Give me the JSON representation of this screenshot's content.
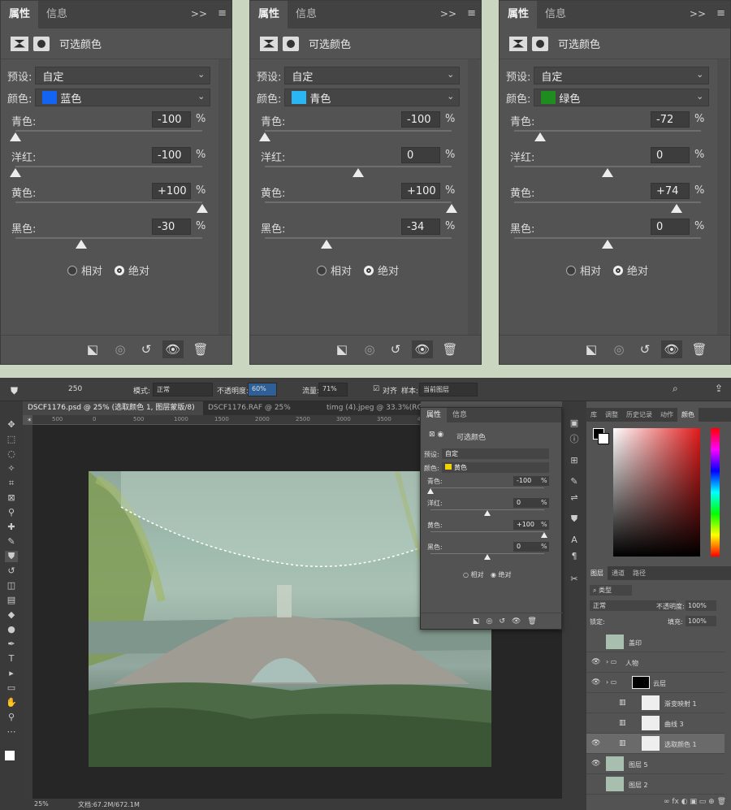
{
  "panels": [
    {
      "tabs": [
        "属性",
        "信息"
      ],
      "title": "可选颜色",
      "preset_label": "预设:",
      "preset_value": "自定",
      "color_label": "颜色:",
      "color_value": "蓝色",
      "color_swatch": "#1464f4",
      "sliders": [
        {
          "label": "青色:",
          "value": "-100",
          "pct": "%",
          "level": -100
        },
        {
          "label": "洋红:",
          "value": "-100",
          "pct": "%",
          "level": -100
        },
        {
          "label": "黄色:",
          "value": "+100",
          "pct": "%",
          "level": 100
        },
        {
          "label": "黑色:",
          "value": "-30",
          "pct": "%",
          "level": -30
        }
      ],
      "radio_relative": "相对",
      "radio_absolute": "绝对"
    },
    {
      "tabs": [
        "属性",
        "信息"
      ],
      "title": "可选颜色",
      "preset_label": "预设:",
      "preset_value": "自定",
      "color_label": "颜色:",
      "color_value": "青色",
      "color_swatch": "#2ab6f4",
      "sliders": [
        {
          "label": "青色:",
          "value": "-100",
          "pct": "%",
          "level": -100
        },
        {
          "label": "洋红:",
          "value": "0",
          "pct": "%",
          "level": 0
        },
        {
          "label": "黄色:",
          "value": "+100",
          "pct": "%",
          "level": 100
        },
        {
          "label": "黑色:",
          "value": "-34",
          "pct": "%",
          "level": -34
        }
      ],
      "radio_relative": "相对",
      "radio_absolute": "绝对"
    },
    {
      "tabs": [
        "属性",
        "信息"
      ],
      "title": "可选颜色",
      "preset_label": "预设:",
      "preset_value": "自定",
      "color_label": "颜色:",
      "color_value": "绿色",
      "color_swatch": "#1f8c1f",
      "sliders": [
        {
          "label": "青色:",
          "value": "-72",
          "pct": "%",
          "level": -72
        },
        {
          "label": "洋红:",
          "value": "0",
          "pct": "%",
          "level": 0
        },
        {
          "label": "黄色:",
          "value": "+74",
          "pct": "%",
          "level": 74
        },
        {
          "label": "黑色:",
          "value": "0",
          "pct": "%",
          "level": 0
        }
      ],
      "radio_relative": "相对",
      "radio_absolute": "绝对"
    }
  ],
  "options_bar": {
    "brush_size": "250",
    "mode_label": "模式:",
    "mode_value": "正常",
    "opacity_label": "不透明度:",
    "opacity_value": "60%",
    "flow_label": "流量:",
    "flow_value": "71%",
    "align_label": "对齐",
    "sample_label": "样本:",
    "sample_value": "当前图层"
  },
  "doc_tabs": [
    "DSCF1176.psd @ 25% (选取颜色 1, 图层蒙版/8) *",
    "DSCF1176.RAF @ 25%(RGB/8)",
    "timg (4).jpeg @ 33.3%(RG"
  ],
  "ruler_ticks": [
    "500",
    "0",
    "500",
    "1000",
    "1500",
    "2000",
    "2500",
    "3000",
    "3500",
    "40"
  ],
  "status": {
    "zoom": "25%",
    "doc": "文档:67.2M/672.1M"
  },
  "float_panel": {
    "tabs": [
      "属性",
      "信息"
    ],
    "title": "可选颜色",
    "preset_label": "预设:",
    "preset_value": "自定",
    "color_label": "颜色:",
    "color_value": "黄色",
    "color_swatch": "#f2d200",
    "sliders": [
      {
        "label": "青色:",
        "value": "-100",
        "pct": "%",
        "level": -100
      },
      {
        "label": "洋红:",
        "value": "0",
        "pct": "%",
        "level": 0
      },
      {
        "label": "黄色:",
        "value": "+100",
        "pct": "%",
        "level": 100
      },
      {
        "label": "黑色:",
        "value": "0",
        "pct": "%",
        "level": 0
      }
    ],
    "radio_relative": "相对",
    "radio_absolute": "绝对"
  },
  "right_panel": {
    "top_tabs": [
      "库",
      "调整",
      "历史记录",
      "动作",
      "颜色"
    ],
    "layer_tabs": [
      "图层",
      "通道",
      "路径"
    ],
    "kind_label": "类型",
    "blend_mode": "正常",
    "opacity_label": "不透明度:",
    "opacity_value": "100%",
    "lock_label": "锁定:",
    "fill_label": "填充:",
    "fill_value": "100%",
    "layers": [
      {
        "name": "盖印",
        "visible": false,
        "selected": false
      },
      {
        "name": "人物",
        "visible": true,
        "selected": false
      },
      {
        "name": "云层",
        "visible": true,
        "selected": false
      },
      {
        "name": "渐变映射 1",
        "visible": false,
        "selected": false
      },
      {
        "name": "曲线 3",
        "visible": false,
        "selected": false
      },
      {
        "name": "选取颜色 1",
        "visible": true,
        "selected": true
      },
      {
        "name": "图层 5",
        "visible": true,
        "selected": false
      },
      {
        "name": "图层 2",
        "visible": false,
        "selected": false
      }
    ]
  }
}
